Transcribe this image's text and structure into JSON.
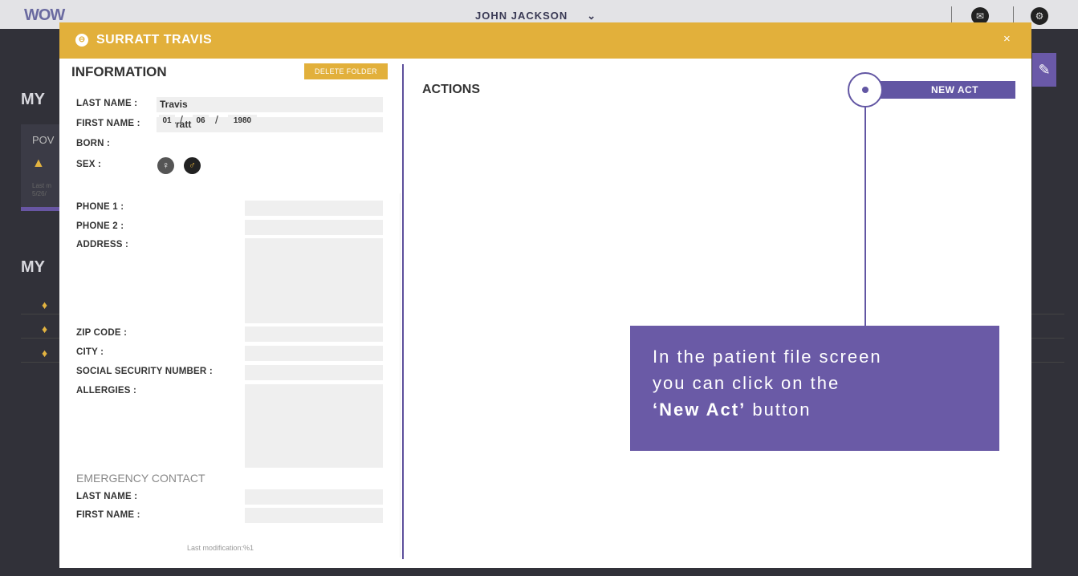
{
  "topbar": {
    "logo": "WOW",
    "user_name": "JOHN JACKSON",
    "user_chevron": "⌄",
    "icon1": "chat-icon",
    "icon2": "settings-icon"
  },
  "background": {
    "heading1": "MY",
    "heading2": "MY",
    "card_title": "POV",
    "card_small": "Last m\n5/26/",
    "tool_icon": "pen-icon"
  },
  "modal": {
    "title": "SURRATT TRAVIS",
    "close": "×",
    "info_title": "INFORMATION",
    "delete_label": "DELETE FOLDER",
    "labels": {
      "last_name": "LAST NAME :",
      "first_name": "FIRST NAME :",
      "born": "BORN :",
      "sex": "SEX :",
      "phone1": "PHONE 1 :",
      "phone2": "PHONE 2 :",
      "address": "ADDRESS :",
      "zip": "ZIP CODE :",
      "city": "CITY :",
      "ssn": "SOCIAL SECURITY NUMBER :",
      "allergies": "ALLERGIES :",
      "emergency": "EMERGENCY CONTACT",
      "ec_last_name": "LAST NAME :",
      "ec_first_name": "FIRST NAME :"
    },
    "values": {
      "last_name": "Travis",
      "first_name": "Surratt",
      "born_day": "01",
      "born_month": "06",
      "born_year": "1980",
      "date_sep": "/"
    },
    "last_modification": "Last modification:%1",
    "actions_title": "ACTIONS",
    "new_act_label": "NEW ACT"
  },
  "callout": {
    "line1": "In the patient file screen",
    "line2": "you can click on the",
    "bold": "‘New Act’",
    "rest": " button"
  }
}
